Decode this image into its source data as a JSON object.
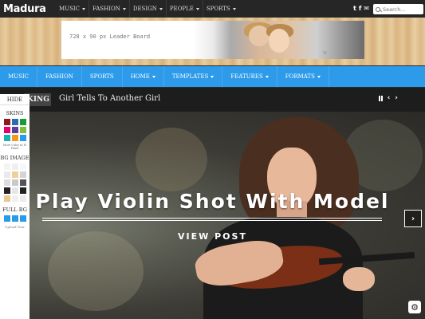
{
  "logo": "Madura",
  "top_nav": [
    "MUSIC",
    "FASHION",
    "DESIGN",
    "PEOPLE",
    "SPORTS"
  ],
  "social_icons": [
    "twitter-icon",
    "facebook-icon",
    "mail-icon"
  ],
  "search": {
    "placeholder": "Search..."
  },
  "ad": {
    "text": "728 x 90 px Leader Board"
  },
  "main_nav": [
    {
      "label": "MUSIC",
      "dropdown": false
    },
    {
      "label": "FASHION",
      "dropdown": false
    },
    {
      "label": "SPORTS",
      "dropdown": false
    },
    {
      "label": "HOME",
      "dropdown": true
    },
    {
      "label": "TEMPLATES",
      "dropdown": true
    },
    {
      "label": "FEATURES",
      "dropdown": true
    },
    {
      "label": "FORMATS",
      "dropdown": true
    }
  ],
  "trending": {
    "badge": "KING",
    "headline": "Girl Tells To Another Girl"
  },
  "hero": {
    "title": "Play Violin Shot With Model",
    "cta": "VIEW POST"
  },
  "style_panel": {
    "hide": "HIDE",
    "skins_label": "SKINS",
    "skin_colors": [
      "#8b1c1c",
      "#2d6bb5",
      "#1a9b36",
      "#e4006e",
      "#5a3d99",
      "#7fbf3a",
      "#17b6b0",
      "#f29a1f",
      "#2a9be8"
    ],
    "more_colors": "More Color in W Panel",
    "bg_image_label": "BG IMAGE",
    "full_bg_label": "FULL BG",
    "full_bg_colors": [
      "#2a9be8",
      "#2a9be8",
      "#2a9be8"
    ],
    "bottom_text": "Upload Your"
  },
  "colors": {
    "accent": "#2d9bea",
    "topbar": "#262626",
    "trending_bg": "#1d1d1d"
  }
}
